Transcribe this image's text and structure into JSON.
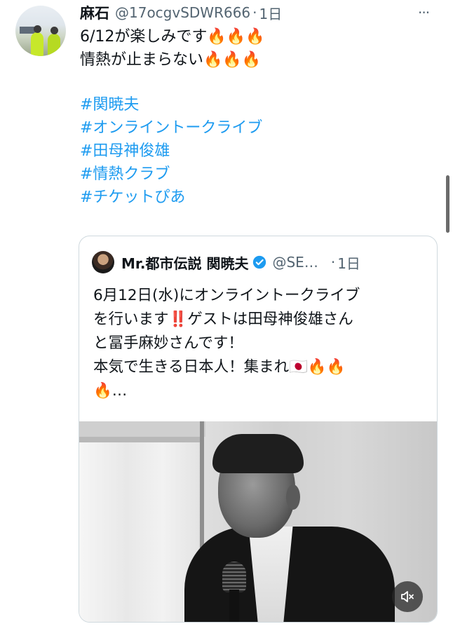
{
  "tweet": {
    "author_name": "麻石",
    "handle": "@17ocgvSDWR666",
    "separator": "·",
    "time": "1日",
    "more_label": "···",
    "lines": [
      "6/12が楽しみです🔥🔥🔥",
      "情熱が止まらない🔥🔥🔥"
    ],
    "hashtags": [
      "#関暁夫",
      "#オンライントークライブ",
      "#田母神俊雄",
      "#情熱クラブ",
      "#チケットぴあ"
    ]
  },
  "quote": {
    "author_name": "Mr.都市伝説 関暁夫",
    "handle": "@SE…",
    "separator": "·",
    "time": "1日",
    "lines": [
      "6月12日(水)にオンライントークライブ",
      "を行います‼️ゲストは田母神俊雄さん",
      "と冨手麻妙さんです！",
      "本気で生きる日本人！集まれ🇯🇵🔥🔥",
      "🔥…"
    ]
  },
  "colors": {
    "link": "#1d9bf0",
    "secondary_text": "#536471",
    "border": "#cfd9de",
    "verified": "#1d9bf0"
  },
  "icons": {
    "more": "more-icon",
    "verified": "verified-badge-icon",
    "mute": "volume-mute-icon"
  }
}
